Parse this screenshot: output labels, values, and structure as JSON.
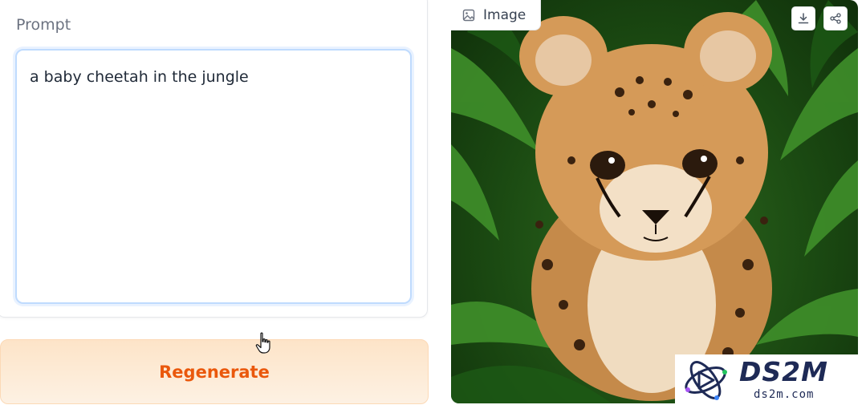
{
  "prompt": {
    "label": "Prompt",
    "value": "a baby cheetah in the jungle"
  },
  "actions": {
    "regenerate_label": "Regenerate"
  },
  "image_output": {
    "tab_label": "Image",
    "download_icon": "download-icon",
    "share_icon": "share-icon"
  },
  "watermark": {
    "title": "DS2M",
    "subtitle": "ds2m.com"
  },
  "colors": {
    "accent_orange": "#ea580c",
    "focus_border": "#bfdbfe",
    "watermark_navy": "#1e2a56"
  }
}
